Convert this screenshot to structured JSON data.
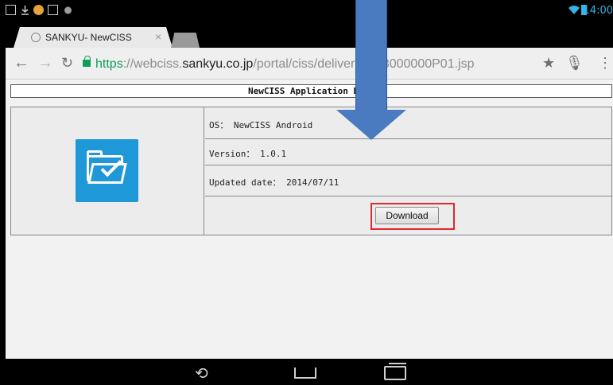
{
  "status_bar": {
    "time": "14:00",
    "left_icons": [
      "screenshot-icon",
      "download-icon",
      "browser-notification-icon",
      "sd-card-icon",
      "android-debug-icon"
    ],
    "right_icons": [
      "wifi-icon",
      "battery-icon"
    ]
  },
  "browser": {
    "tab_title": "SANKYU- NewCISS",
    "url_scheme": "https",
    "url_sep": "://",
    "url_prefix": "webciss.",
    "url_host": "sankyu.co.jp",
    "url_path": "/portal/ciss/delivery/",
    "url_path_end": "3000000P01.jsp"
  },
  "page": {
    "title": "NewCISS Application Down",
    "os_line": "OS： NewCISS Android",
    "version_line": "Version： 1.0.1",
    "updated_line": "Updated date： 2014/07/11",
    "download_label": "Download",
    "app_icon": "folder-check-icon"
  },
  "colors": {
    "highlight": "#e5262b",
    "callout_arrow": "#4a7bc0",
    "time": "#33b5e5",
    "secure": "#0f9d58"
  }
}
